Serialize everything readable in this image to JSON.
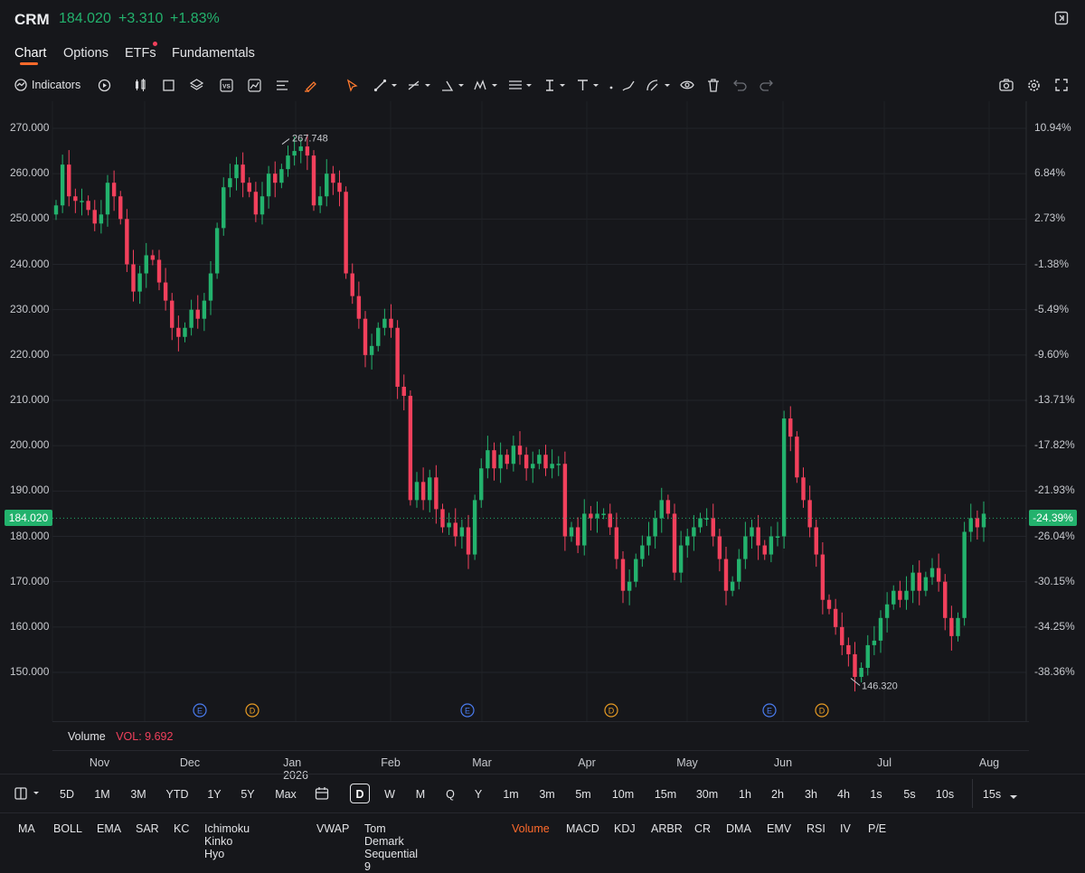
{
  "header": {
    "symbol": "CRM",
    "price": "184.020",
    "change": "+3.310",
    "change_pct": "+1.83%",
    "accent_up": "#23b26d",
    "accent_down": "#f2405c"
  },
  "tabs": [
    {
      "label": "Chart",
      "active": true
    },
    {
      "label": "Options",
      "active": false
    },
    {
      "label": "ETFs",
      "active": false,
      "notification_dot": true
    },
    {
      "label": "Fundamentals",
      "active": false
    }
  ],
  "toolbar": {
    "indicators_label": "Indicators",
    "icons": [
      "replay-icon",
      "candle-type-icon",
      "rectangle-icon",
      "layers-icon",
      "vs-compare-icon",
      "chart-analysis-icon",
      "text-lines-icon",
      "highlighter-icon",
      "cursor-icon",
      "trend-line-icon",
      "fib-icon",
      "angle-icon",
      "pattern-icon",
      "channel-icon",
      "vertical-text-icon",
      "text-tool-icon",
      "more-dots-icon",
      "brush-icon",
      "measure-icon",
      "eye-icon",
      "trash-icon",
      "undo-icon",
      "redo-icon",
      "camera-icon",
      "settings-icon",
      "fullscreen-icon"
    ]
  },
  "chart_data": {
    "type": "candlestick",
    "y_ticks": [
      "270.000",
      "260.000",
      "250.000",
      "240.000",
      "230.000",
      "220.000",
      "210.000",
      "200.000",
      "190.000",
      "180.000",
      "170.000",
      "160.000",
      "150.000"
    ],
    "pct_ticks": [
      "10.94%",
      "6.84%",
      "2.73%",
      "-1.38%",
      "-5.49%",
      "-9.60%",
      "-13.71%",
      "-17.82%",
      "-21.93%",
      "-26.04%",
      "-30.15%",
      "-34.25%",
      "-38.36%"
    ],
    "ylim": [
      140.8,
      272.8
    ],
    "current_price_label": "184.020",
    "current_pct_label": "-24.39%",
    "high_label": "267.748",
    "low_label": "146.320",
    "months": [
      "Nov",
      "Dec",
      "Jan 2026",
      "Feb",
      "Mar",
      "Apr",
      "May",
      "Jun",
      "Jul",
      "Aug"
    ],
    "event_markers": [
      {
        "label": "E",
        "kind": "earnings"
      },
      {
        "label": "D",
        "kind": "dividend"
      },
      {
        "label": "E",
        "kind": "earnings"
      },
      {
        "label": "D",
        "kind": "dividend"
      },
      {
        "label": "E",
        "kind": "earnings"
      },
      {
        "label": "D",
        "kind": "dividend"
      }
    ],
    "closes": [
      253,
      262,
      255,
      254,
      254,
      252,
      249,
      251,
      258,
      255,
      250,
      240,
      234,
      238,
      242,
      241,
      236,
      232,
      226,
      224,
      226,
      230,
      228,
      232,
      238,
      248,
      257,
      259,
      262,
      258,
      256,
      251,
      255,
      260,
      258,
      261,
      264,
      265,
      266,
      264,
      253,
      255,
      260,
      258,
      256,
      238,
      233,
      228,
      220,
      222,
      226,
      228,
      226,
      213,
      211,
      188,
      192,
      188,
      193,
      186,
      182,
      183,
      180,
      182,
      176,
      188,
      195,
      199,
      195,
      198,
      196,
      200,
      198,
      195,
      196,
      198,
      195,
      196,
      196,
      180,
      182,
      178,
      185,
      184,
      185,
      185,
      182,
      175,
      168,
      170,
      175,
      178,
      180,
      184,
      188,
      185,
      172,
      178,
      180,
      182,
      184,
      184,
      180,
      175,
      168,
      170,
      175,
      180,
      182,
      178,
      176,
      180,
      180,
      206,
      202,
      193,
      188,
      182,
      176,
      166,
      164,
      160,
      156,
      154,
      149,
      151,
      156,
      157,
      162,
      165,
      168,
      166,
      168,
      172,
      168,
      171,
      173,
      170,
      162,
      158,
      162,
      181,
      184,
      182,
      185
    ]
  },
  "volume": {
    "label": "Volume",
    "value_label": "VOL: 9.692"
  },
  "periods": [
    "5D",
    "1M",
    "3M",
    "YTD",
    "1Y",
    "5Y",
    "Max"
  ],
  "intervals": [
    "D",
    "W",
    "M",
    "Q",
    "Y",
    "1m",
    "3m",
    "5m",
    "10m",
    "15m",
    "30m",
    "1h",
    "2h",
    "3h",
    "4h",
    "1s",
    "5s",
    "10s",
    "15s"
  ],
  "selected_interval": "D",
  "indicators": [
    {
      "label": "MA",
      "active": false
    },
    {
      "label": "BOLL",
      "active": false
    },
    {
      "label": "EMA",
      "active": false
    },
    {
      "label": "SAR",
      "active": false
    },
    {
      "label": "KC",
      "active": false
    },
    {
      "label": "Ichimoku Kinko Hyo",
      "active": false
    },
    {
      "label": "VWAP",
      "active": false
    },
    {
      "label": "Tom Demark Sequential 9",
      "active": false
    },
    {
      "label": "Volume",
      "active": true
    },
    {
      "label": "MACD",
      "active": false
    },
    {
      "label": "KDJ",
      "active": false
    },
    {
      "label": "ARBR",
      "active": false
    },
    {
      "label": "CR",
      "active": false
    },
    {
      "label": "DMA",
      "active": false
    },
    {
      "label": "EMV",
      "active": false
    },
    {
      "label": "RSI",
      "active": false
    },
    {
      "label": "IV",
      "active": false
    },
    {
      "label": "P/E",
      "active": false
    }
  ]
}
